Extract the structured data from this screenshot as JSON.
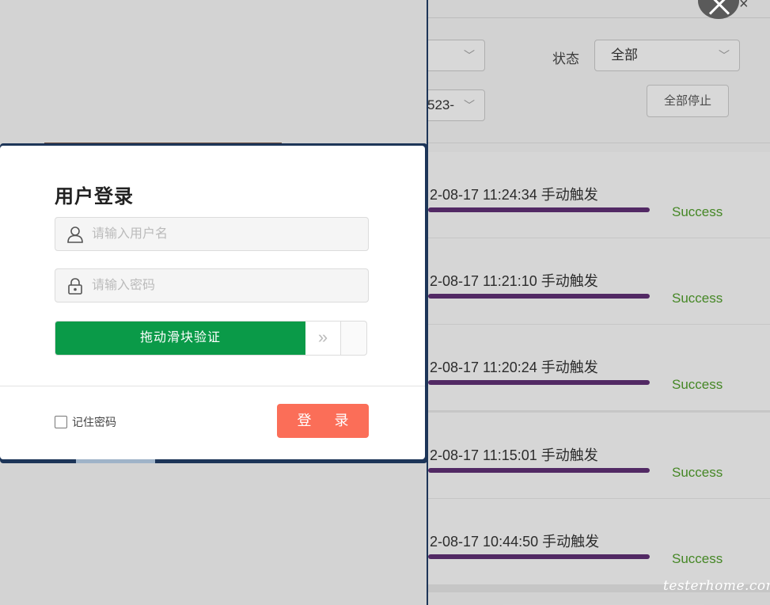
{
  "login": {
    "title": "用户登录",
    "username_placeholder": "请输入用户名",
    "password_placeholder": "请输入密码",
    "slider_text": "拖动滑块验证",
    "slider_handle": "»",
    "remember_label": "记住密码",
    "login_button": "登 录"
  },
  "background": {
    "filter_1_value": "",
    "filter_2_value": "523-",
    "status_label": "状态",
    "status_value": "全部",
    "stop_all_button": "全部停止",
    "runs": [
      {
        "time": "2-08-17 11:24:34 手动触发",
        "status": "Success"
      },
      {
        "time": "2-08-17 11:21:10 手动触发",
        "status": "Success"
      },
      {
        "time": "2-08-17 11:20:24 手动触发",
        "status": "Success"
      },
      {
        "time": "2-08-17 11:15:01 手动触发",
        "status": "Success"
      },
      {
        "time": "2-08-17 10:44:50 手动触发",
        "status": "Success"
      }
    ]
  },
  "close_glyph": "×",
  "watermark": "testerhome.com",
  "colors": {
    "slider_green": "#0a9a48",
    "login_orange": "#fb6e58",
    "success_green": "#4f9a2b",
    "progress_purple": "#5e2f72",
    "dialog_border": "#1d3558"
  },
  "icons": {
    "username": "user-icon",
    "password": "lock-icon",
    "close": "close-icon",
    "dropdown": "chevron-down-icon"
  }
}
